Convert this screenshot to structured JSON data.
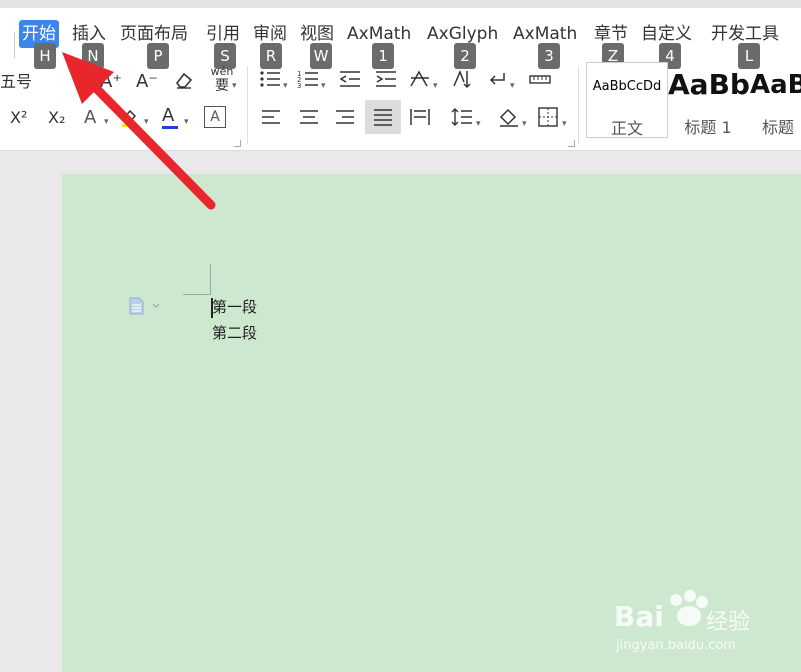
{
  "tabs": [
    {
      "label": "开始",
      "key": "H",
      "active": true
    },
    {
      "label": "插入",
      "key": "N"
    },
    {
      "label": "页面布局",
      "key": "P"
    },
    {
      "label": "引用",
      "key": "S"
    },
    {
      "label": "审阅",
      "key": "R"
    },
    {
      "label": "视图",
      "key": "W"
    },
    {
      "label": "AxMath",
      "key": "1"
    },
    {
      "label": "AxGlyph",
      "key": "2"
    },
    {
      "label": "AxMath",
      "key": "3"
    },
    {
      "label": "章节",
      "key": "Z"
    },
    {
      "label": "自定义",
      "key": "4"
    },
    {
      "label": "开发工具",
      "key": "L"
    }
  ],
  "font": {
    "size": "五号"
  },
  "toolbar": {
    "grow_font": "A⁺",
    "shrink_font": "A⁻",
    "phonetic": "wén",
    "superscript": "X²",
    "subscript": "X₂",
    "text_effect": "A",
    "font_color": "A",
    "char_border": "A"
  },
  "styles": [
    {
      "sample": "AaBbCcDd",
      "name": "正文"
    },
    {
      "sample": "AaBb",
      "name": "标题 1"
    },
    {
      "sample": "AaB",
      "name": "标题"
    }
  ],
  "document": {
    "paragraphs": [
      "第一段",
      "第二段"
    ]
  },
  "watermark": {
    "brand": "Bai",
    "brand2": "经验",
    "url": "jingyan.baidu.com"
  },
  "colors": {
    "accent": "#3b86e8",
    "page": "#cde8cf",
    "arrow": "#e8262b",
    "key_badge": "#6b6b6b"
  }
}
